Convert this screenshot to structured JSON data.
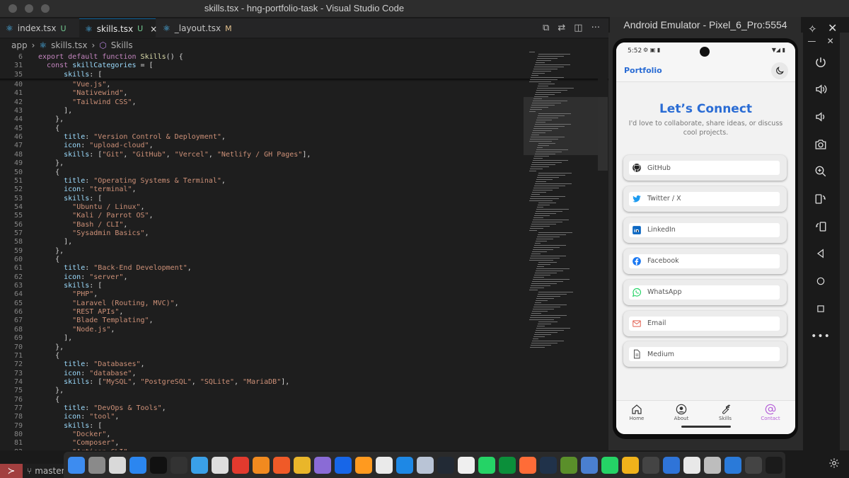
{
  "window": {
    "title": "skills.tsx - hng-portfolio-task - Visual Studio Code",
    "emulator_title": "Android Emulator - Pixel_6_Pro:5554"
  },
  "tabs": [
    {
      "label": "index.tsx",
      "status": "U",
      "status_color": "#73c991"
    },
    {
      "label": "skills.tsx",
      "status": "U",
      "status_color": "#73c991"
    },
    {
      "label": "_layout.tsx",
      "status": "M",
      "status_color": "#e2c08d"
    }
  ],
  "breadcrumb": {
    "folder": "app",
    "file": "skills.tsx",
    "symbol": "Skills"
  },
  "code": {
    "sticky": [
      {
        "n": "6",
        "t": "export default function Skills() {"
      },
      {
        "n": "31",
        "t": "  const skillCategories = ["
      },
      {
        "n": "35",
        "t": "      skills: ["
      }
    ],
    "lines": [
      {
        "n": "40",
        "t": "        \"Vue.js\","
      },
      {
        "n": "41",
        "t": "        \"Nativewind\","
      },
      {
        "n": "42",
        "t": "        \"Tailwind CSS\","
      },
      {
        "n": "43",
        "t": "      ],"
      },
      {
        "n": "44",
        "t": "    },"
      },
      {
        "n": "45",
        "t": "    {"
      },
      {
        "n": "46",
        "t": "      title: \"Version Control & Deployment\","
      },
      {
        "n": "47",
        "t": "      icon: \"upload-cloud\","
      },
      {
        "n": "48",
        "t": "      skills: [\"Git\", \"GitHub\", \"Vercel\", \"Netlify / GH Pages\"],"
      },
      {
        "n": "49",
        "t": "    },"
      },
      {
        "n": "50",
        "t": "    {"
      },
      {
        "n": "51",
        "t": "      title: \"Operating Systems & Terminal\","
      },
      {
        "n": "52",
        "t": "      icon: \"terminal\","
      },
      {
        "n": "53",
        "t": "      skills: ["
      },
      {
        "n": "54",
        "t": "        \"Ubuntu / Linux\","
      },
      {
        "n": "55",
        "t": "        \"Kali / Parrot OS\","
      },
      {
        "n": "56",
        "t": "        \"Bash / CLI\","
      },
      {
        "n": "57",
        "t": "        \"Sysadmin Basics\","
      },
      {
        "n": "58",
        "t": "      ],"
      },
      {
        "n": "59",
        "t": "    },"
      },
      {
        "n": "60",
        "t": "    {"
      },
      {
        "n": "61",
        "t": "      title: \"Back-End Development\","
      },
      {
        "n": "62",
        "t": "      icon: \"server\","
      },
      {
        "n": "63",
        "t": "      skills: ["
      },
      {
        "n": "64",
        "t": "        \"PHP\","
      },
      {
        "n": "65",
        "t": "        \"Laravel (Routing, MVC)\","
      },
      {
        "n": "66",
        "t": "        \"REST APIs\","
      },
      {
        "n": "67",
        "t": "        \"Blade Templating\","
      },
      {
        "n": "68",
        "t": "        \"Node.js\","
      },
      {
        "n": "69",
        "t": "      ],"
      },
      {
        "n": "70",
        "t": "    },"
      },
      {
        "n": "71",
        "t": "    {"
      },
      {
        "n": "72",
        "t": "      title: \"Databases\","
      },
      {
        "n": "73",
        "t": "      icon: \"database\","
      },
      {
        "n": "74",
        "t": "      skills: [\"MySQL\", \"PostgreSQL\", \"SQLite\", \"MariaDB\"],"
      },
      {
        "n": "75",
        "t": "    },"
      },
      {
        "n": "76",
        "t": "    {"
      },
      {
        "n": "77",
        "t": "      title: \"DevOps & Tools\","
      },
      {
        "n": "78",
        "t": "      icon: \"tool\","
      },
      {
        "n": "79",
        "t": "      skills: ["
      },
      {
        "n": "80",
        "t": "        \"Docker\","
      },
      {
        "n": "81",
        "t": "        \"Composer\","
      },
      {
        "n": "82",
        "t": "        \"Artisan CLI\","
      }
    ]
  },
  "status": {
    "branch": "master"
  },
  "phone": {
    "time": "5:52",
    "app_title": "Portfolio",
    "heading": "Let’s Connect",
    "subtitle": "I'd love to collaborate, share ideas, or discuss cool projects.",
    "links": [
      {
        "label": "GitHub",
        "icon": "github-icon"
      },
      {
        "label": "Twitter / X",
        "icon": "twitter-icon"
      },
      {
        "label": "LinkedIn",
        "icon": "linkedin-icon"
      },
      {
        "label": "Facebook",
        "icon": "facebook-icon"
      },
      {
        "label": "WhatsApp",
        "icon": "whatsapp-icon"
      },
      {
        "label": "Email",
        "icon": "email-icon"
      },
      {
        "label": "Medium",
        "icon": "document-icon"
      }
    ],
    "nav": [
      {
        "label": "Home",
        "icon": "home-icon"
      },
      {
        "label": "About",
        "icon": "user-icon"
      },
      {
        "label": "Skills",
        "icon": "wrench-icon"
      },
      {
        "label": "Contact",
        "icon": "at-icon",
        "active": true
      }
    ],
    "accent": "#2a6cd4",
    "active_nav_color": "#b660d8"
  },
  "dock": [
    {
      "name": "finder-icon",
      "color": "#3d8cf0"
    },
    {
      "name": "settings-icon",
      "color": "#8a8a8a"
    },
    {
      "name": "launchpad-icon",
      "color": "#d9d9d9"
    },
    {
      "name": "app-store-icon",
      "color": "#2b86f0"
    },
    {
      "name": "terminal-icon",
      "color": "#111111"
    },
    {
      "name": "warp-icon",
      "color": "#333333"
    },
    {
      "name": "cube-icon",
      "color": "#3aa0e8"
    },
    {
      "name": "notes-icon",
      "color": "#dddddd"
    },
    {
      "name": "acrobat-icon",
      "color": "#e23a2e"
    },
    {
      "name": "vlc-icon",
      "color": "#f18a1f"
    },
    {
      "name": "brave-icon",
      "color": "#f05a28"
    },
    {
      "name": "chrome-icon",
      "color": "#e9b62a"
    },
    {
      "name": "tor-icon",
      "color": "#8a6bd6"
    },
    {
      "name": "firefox-icon",
      "color": "#1766e8"
    },
    {
      "name": "sublime-icon",
      "color": "#ff9a1f"
    },
    {
      "name": "chatgpt-icon",
      "color": "#eaeaea"
    },
    {
      "name": "vscode-icon",
      "color": "#1e88e5"
    },
    {
      "name": "preview-icon",
      "color": "#b9c4d6"
    },
    {
      "name": "android-studio-icon",
      "color": "#222a35"
    },
    {
      "name": "node-icon",
      "color": "#efefef"
    },
    {
      "name": "whatsapp-icon",
      "color": "#25d366"
    },
    {
      "name": "vim-icon",
      "color": "#0b8f3a"
    },
    {
      "name": "postman-icon",
      "color": "#ff6c37"
    },
    {
      "name": "atlas-icon",
      "color": "#20324a"
    },
    {
      "name": "box-icon",
      "color": "#5a8f2a"
    },
    {
      "name": "wireshark-icon",
      "color": "#4a7fd0"
    },
    {
      "name": "whatsapp2-icon",
      "color": "#25d366"
    },
    {
      "name": "sketch-icon",
      "color": "#f0b21b"
    },
    {
      "name": "utility-icon",
      "color": "#444444"
    },
    {
      "name": "drive-icon",
      "color": "#2f74d8"
    },
    {
      "name": "screenshot-icon",
      "color": "#e8e8e8"
    },
    {
      "name": "trash-icon",
      "color": "#bdbdbd"
    },
    {
      "name": "finder2-icon",
      "color": "#2a7ad9"
    },
    {
      "name": "tablet-icon",
      "color": "#444444"
    },
    {
      "name": "clock-icon",
      "color": "#1b1b1b"
    }
  ]
}
